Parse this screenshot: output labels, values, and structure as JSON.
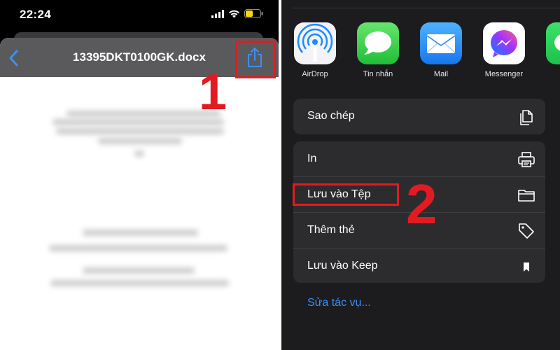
{
  "status_bar": {
    "time": "22:24"
  },
  "document": {
    "title": "13395DKT0100GK.docx"
  },
  "steps": {
    "step1": "1",
    "step2": "2"
  },
  "share_apps": [
    {
      "label": "AirDrop"
    },
    {
      "label": "Tin nhắn"
    },
    {
      "label": "Mail"
    },
    {
      "label": "Messenger"
    }
  ],
  "actions": {
    "copy": "Sao chép",
    "print": "In",
    "save_to_files": "Lưu vào Tệp",
    "add_tag": "Thêm thẻ",
    "save_to_keep": "Lưu vào Keep"
  },
  "edit_actions": "Sửa tác vụ...",
  "colors": {
    "highlight": "#e21b22",
    "ios_blue": "#3b8ff5",
    "sheet_dark": "#1c1c1e",
    "row_dark": "#2c2c2e"
  },
  "icons": [
    "back-chevron-icon",
    "share-icon",
    "signal-icon",
    "wifi-icon",
    "battery-icon",
    "copy-icon",
    "printer-icon",
    "folder-icon",
    "tag-icon",
    "bookmark-icon"
  ]
}
